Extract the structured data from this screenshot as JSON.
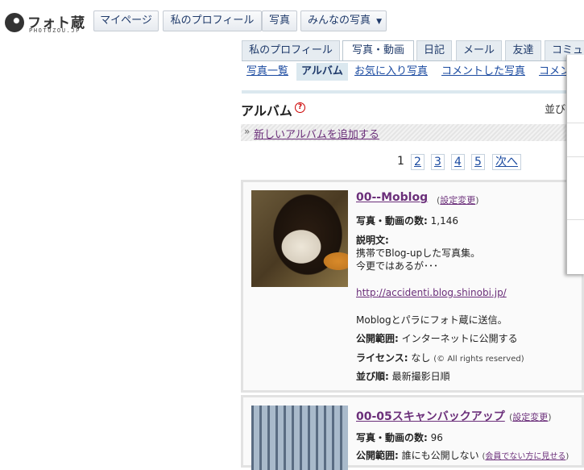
{
  "logo": {
    "text": "フォト蔵",
    "sub": "PHOTOZOU.JP"
  },
  "topnav": [
    {
      "label": "マイページ"
    },
    {
      "label": "私のプロフィール"
    },
    {
      "label": "写真"
    },
    {
      "label": "みんなの写真",
      "dropdown": true
    }
  ],
  "tabs": [
    {
      "label": "私のプロフィール"
    },
    {
      "label": "写真・動画",
      "active": true
    },
    {
      "label": "日記"
    },
    {
      "label": "メール"
    },
    {
      "label": "友達"
    },
    {
      "label": "コミュ"
    }
  ],
  "subtabs": [
    {
      "label": "写真一覧"
    },
    {
      "label": "アルバム",
      "active": true
    },
    {
      "label": "お気に入り写真"
    },
    {
      "label": "コメントした写真"
    },
    {
      "label": "コメン"
    }
  ],
  "page": {
    "title": "アルバム",
    "help": "?",
    "sort_label": "並び",
    "add_album": "新しいアルバムを追加する",
    "raquo": "»"
  },
  "pagination": {
    "current": "1",
    "pages": [
      "2",
      "3",
      "4",
      "5"
    ],
    "next": "次へ"
  },
  "albums": [
    {
      "title": "00--Moblog",
      "settings": "設定変更",
      "count_label": "写真・動画の数:",
      "count": "1,146",
      "desc_label": "説明文:",
      "desc_line1": "携帯でBlog-upした写真集。",
      "desc_line2": "今更ではあるが･･･",
      "url": "http://accidenti.blog.shinobi.jp/",
      "note": "Moblogとパラにフォト蔵に送信。",
      "scope_label": "公開範囲:",
      "scope": "インターネットに公開する",
      "license_label": "ライセンス:",
      "license": "なし",
      "license_note": "(© All rights reserved)",
      "order_label": "並び順:",
      "order": "最新撮影日順"
    },
    {
      "title": "00-05スキャンバックアップ",
      "settings": "設定変更",
      "count_label": "写真・動画の数:",
      "count": "96",
      "scope_label": "公開範囲:",
      "scope": "誰にも公開しない",
      "scope_link": "会員でない方に見せる"
    }
  ],
  "colors": {
    "link": "#1a4aa0",
    "visited": "#6b2f7a",
    "tab_bg": "#e6ecf1",
    "sub_bg": "#dbe8ef"
  }
}
